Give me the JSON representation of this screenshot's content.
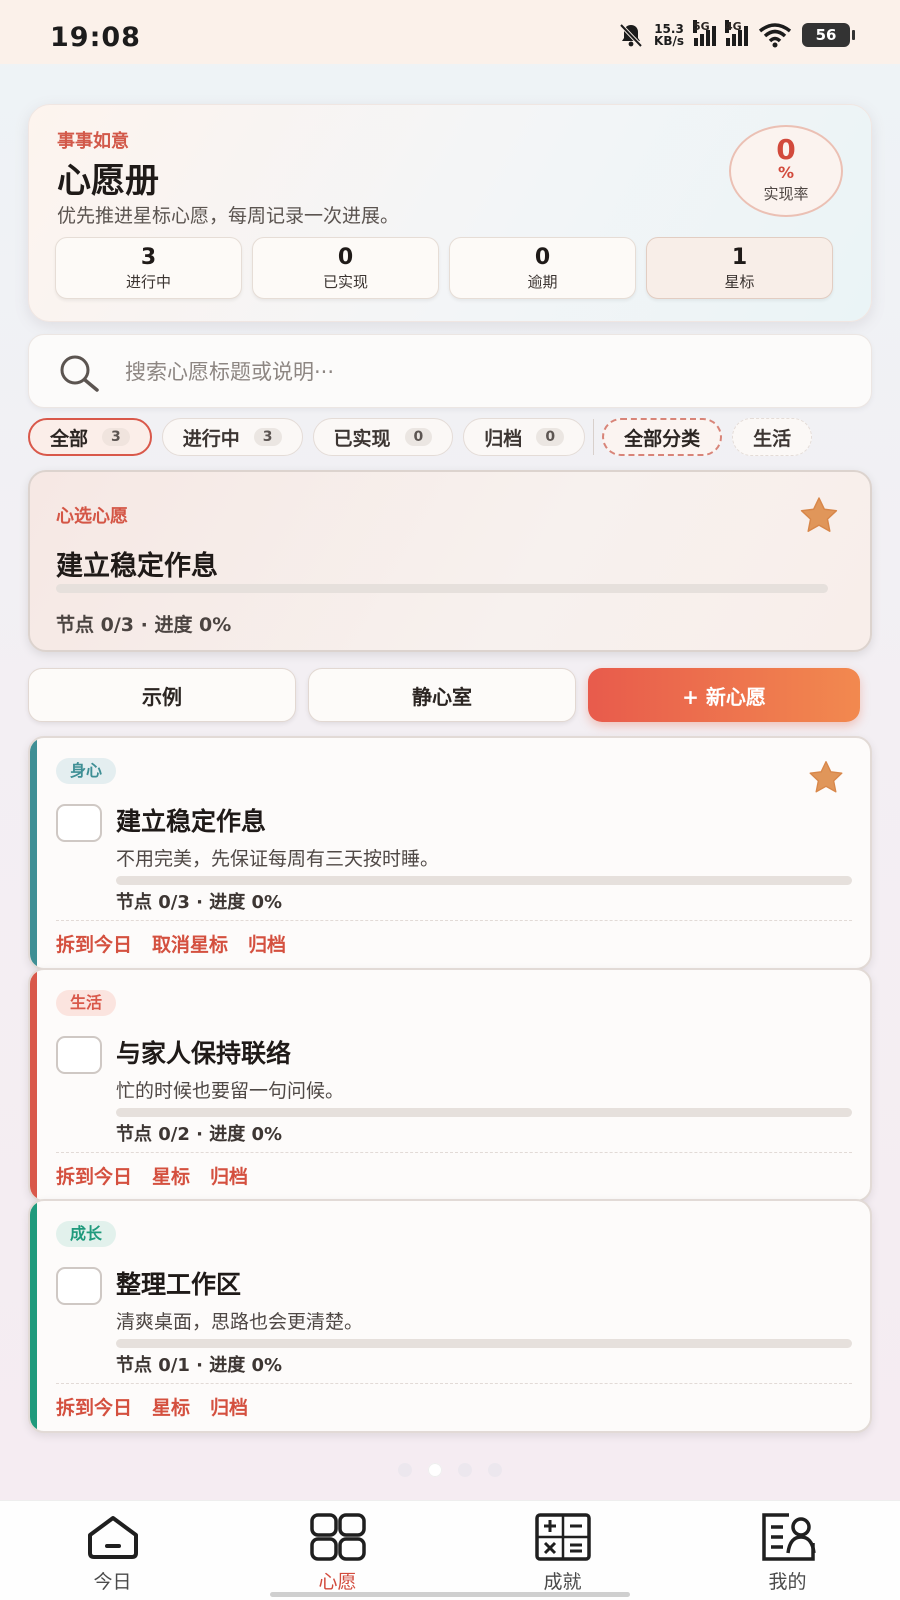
{
  "status_bar": {
    "time": "19:08",
    "net_speed": "15.3",
    "net_unit": "KB/s",
    "net1": "5G",
    "net2": "4G",
    "battery": "56"
  },
  "header": {
    "eyebrow": "事事如意",
    "title": "心愿册",
    "subtitle": "优先推进星标心愿，每周记录一次进展。",
    "rate_value": "0",
    "rate_unit": "%",
    "rate_label": "实现率",
    "stats": [
      {
        "value": "3",
        "label": "进行中"
      },
      {
        "value": "0",
        "label": "已实现"
      },
      {
        "value": "0",
        "label": "逾期"
      },
      {
        "value": "1",
        "label": "星标"
      }
    ]
  },
  "search": {
    "placeholder": "搜索心愿标题或说明···"
  },
  "filters": {
    "status": [
      {
        "label": "全部",
        "count": "3"
      },
      {
        "label": "进行中",
        "count": "3"
      },
      {
        "label": "已实现",
        "count": "0"
      },
      {
        "label": "归档",
        "count": "0"
      }
    ],
    "category_all": "全部分类",
    "category_next": "生活"
  },
  "featured": {
    "label": "心选心愿",
    "title": "建立稳定作息",
    "meta": "节点 0/3 · 进度 0%",
    "progress": 0
  },
  "actions": {
    "example": "示例",
    "quiet_room": "静心室",
    "new_wish": "+ 新心愿"
  },
  "wishes": [
    {
      "tag": "身心",
      "title": "建立稳定作息",
      "desc": "不用完美，先保证每周有三天按时睡。",
      "meta": "节点 0/3 · 进度 0%",
      "progress": 0,
      "starred": true,
      "links": [
        "拆到今日",
        "取消星标",
        "归档"
      ]
    },
    {
      "tag": "生活",
      "title": "与家人保持联络",
      "desc": "忙的时候也要留一句问候。",
      "meta": "节点 0/2 · 进度 0%",
      "progress": 0,
      "starred": false,
      "links": [
        "拆到今日",
        "星标",
        "归档"
      ]
    },
    {
      "tag": "成长",
      "title": "整理工作区",
      "desc": "清爽桌面，思路也会更清楚。",
      "meta": "节点 0/1 · 进度 0%",
      "progress": 0,
      "starred": false,
      "links": [
        "拆到今日",
        "星标",
        "归档"
      ]
    }
  ],
  "bottom_nav": [
    {
      "label": "今日",
      "icon": "home-icon"
    },
    {
      "label": "心愿",
      "icon": "grid-icon"
    },
    {
      "label": "成就",
      "icon": "calculator-icon"
    },
    {
      "label": "我的",
      "icon": "profile-icon"
    }
  ],
  "colors": {
    "accent": "#d24a3c",
    "tag_body": "#3f8f95",
    "tag_life": "#d9584a",
    "tag_growth": "#1f9a7c",
    "star": "#e0965a"
  }
}
